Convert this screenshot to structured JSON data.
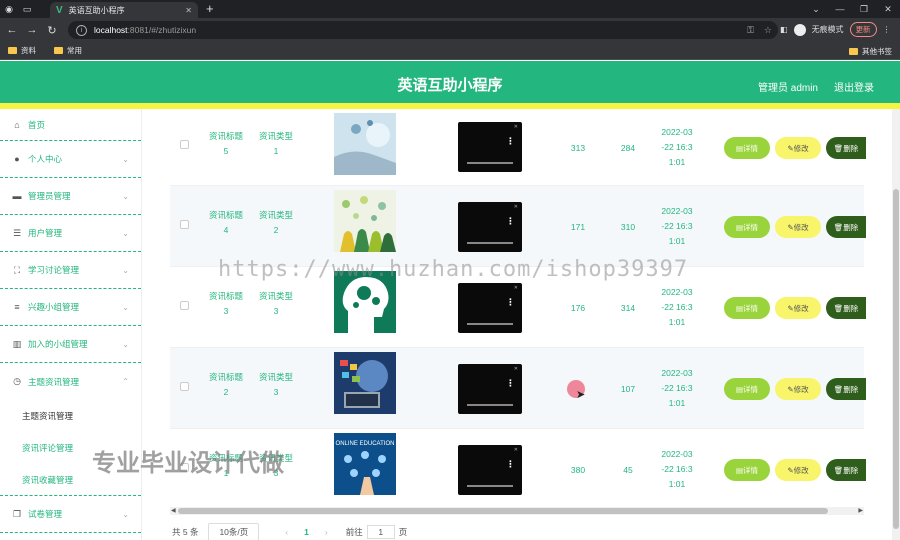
{
  "browser": {
    "tab_title": "英语互助小程序",
    "url_host": "localhost",
    "url_path": ":8081/#/zhutizixun",
    "incognito_label": "无痕模式",
    "update_label": "更新",
    "bookmarks": [
      "资料",
      "常用"
    ],
    "other_bookmarks": "其他书签"
  },
  "header": {
    "title": "英语互助小程序",
    "user": "管理员 admin",
    "logout": "退出登录"
  },
  "sidebar": {
    "home": "首页",
    "items": [
      {
        "label": "个人中心",
        "icon": "user-icon"
      },
      {
        "label": "管理员管理",
        "icon": "card-icon"
      },
      {
        "label": "用户管理",
        "icon": "list-icon"
      },
      {
        "label": "学习讨论管理",
        "icon": "expand-icon"
      },
      {
        "label": "兴趣小组管理",
        "icon": "menu-icon"
      },
      {
        "label": "加入的小组管理",
        "icon": "chart-icon"
      },
      {
        "label": "主题资讯管理",
        "icon": "clock-icon"
      }
    ],
    "subitems": [
      "主题资讯管理",
      "资讯评论管理",
      "资讯收藏管理"
    ],
    "last_item": "试卷管理"
  },
  "table": {
    "rows": [
      {
        "title_l1": "资讯标题",
        "title_l2": "5",
        "type_l1": "资讯类型",
        "type_l2": "1",
        "n1": "313",
        "n2": "284",
        "t1": "2022-03",
        "t2": "-22 16:3",
        "t3": "1:01"
      },
      {
        "title_l1": "资讯标题",
        "title_l2": "4",
        "type_l1": "资讯类型",
        "type_l2": "2",
        "n1": "171",
        "n2": "310",
        "t1": "2022-03",
        "t2": "-22 16:3",
        "t3": "1:01"
      },
      {
        "title_l1": "资讯标题",
        "title_l2": "3",
        "type_l1": "资讯类型",
        "type_l2": "3",
        "n1": "176",
        "n2": "314",
        "t1": "2022-03",
        "t2": "-22 16:3",
        "t3": "1:01"
      },
      {
        "title_l1": "资讯标题",
        "title_l2": "2",
        "type_l1": "资讯类型",
        "type_l2": "3",
        "n1": "",
        "n2": "107",
        "t1": "2022-03",
        "t2": "-22 16:3",
        "t3": "1:01"
      },
      {
        "title_l1": "资讯标题",
        "title_l2": "1",
        "type_l1": "资讯类型",
        "type_l2": "3",
        "n1": "380",
        "n2": "45",
        "t1": "2022-03",
        "t2": "-22 16:3",
        "t3": "1:01"
      }
    ],
    "actions": {
      "detail": "详情",
      "edit": "修改",
      "delete": "删除"
    },
    "thumb5_text": "ONLINE EDUCATION"
  },
  "pager": {
    "total": "共 5 条",
    "page_size": "10条/页",
    "current": "1",
    "goto_label": "前往",
    "goto_value": "1",
    "page_suffix": "页"
  },
  "overlay": {
    "watermark": "https://www.huzhan.com/ishop39397",
    "promo": "专业毕业设计代做"
  },
  "colors": {
    "brand": "#23b67e",
    "accent_bar": "#f5f541",
    "detail": "#9ad43c",
    "edit": "#f8f56b",
    "delete": "#2f5d1b"
  }
}
